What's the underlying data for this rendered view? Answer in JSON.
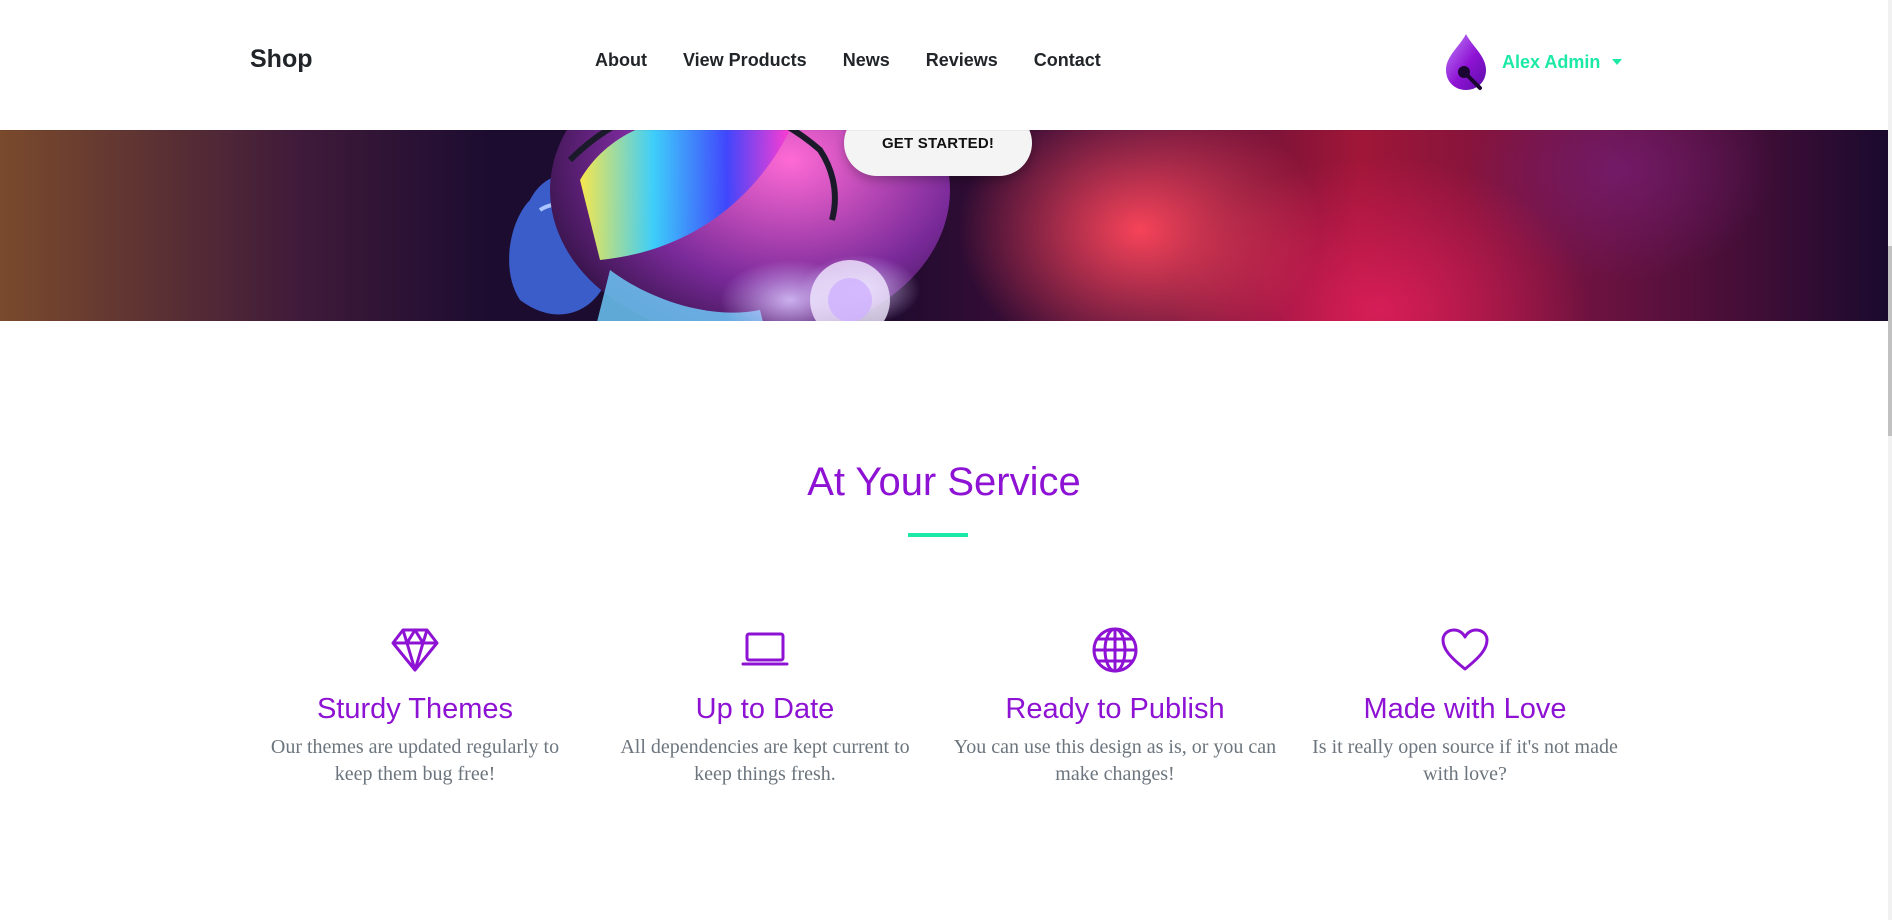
{
  "navbar": {
    "brand": "Shop",
    "links": [
      "About",
      "View Products",
      "News",
      "Reviews",
      "Contact"
    ],
    "user": {
      "name": "Alex Admin",
      "avatar_icon": "flame-avatar-icon"
    }
  },
  "hero": {
    "cta_label": "GET STARTED!"
  },
  "services": {
    "title": "At Your Service",
    "accent_color": "#8e12d3",
    "divider_color": "#1de9a6",
    "items": [
      {
        "icon": "gem-icon",
        "title": "Sturdy Themes",
        "text": "Our themes are updated regularly to keep them bug free!"
      },
      {
        "icon": "laptop-icon",
        "title": "Up to Date",
        "text": "All dependencies are kept current to keep things fresh."
      },
      {
        "icon": "globe-icon",
        "title": "Ready to Publish",
        "text": "You can use this design as is, or you can make changes!"
      },
      {
        "icon": "heart-icon",
        "title": "Made with Love",
        "text": "Is it really open source if it's not made with love?"
      }
    ]
  }
}
